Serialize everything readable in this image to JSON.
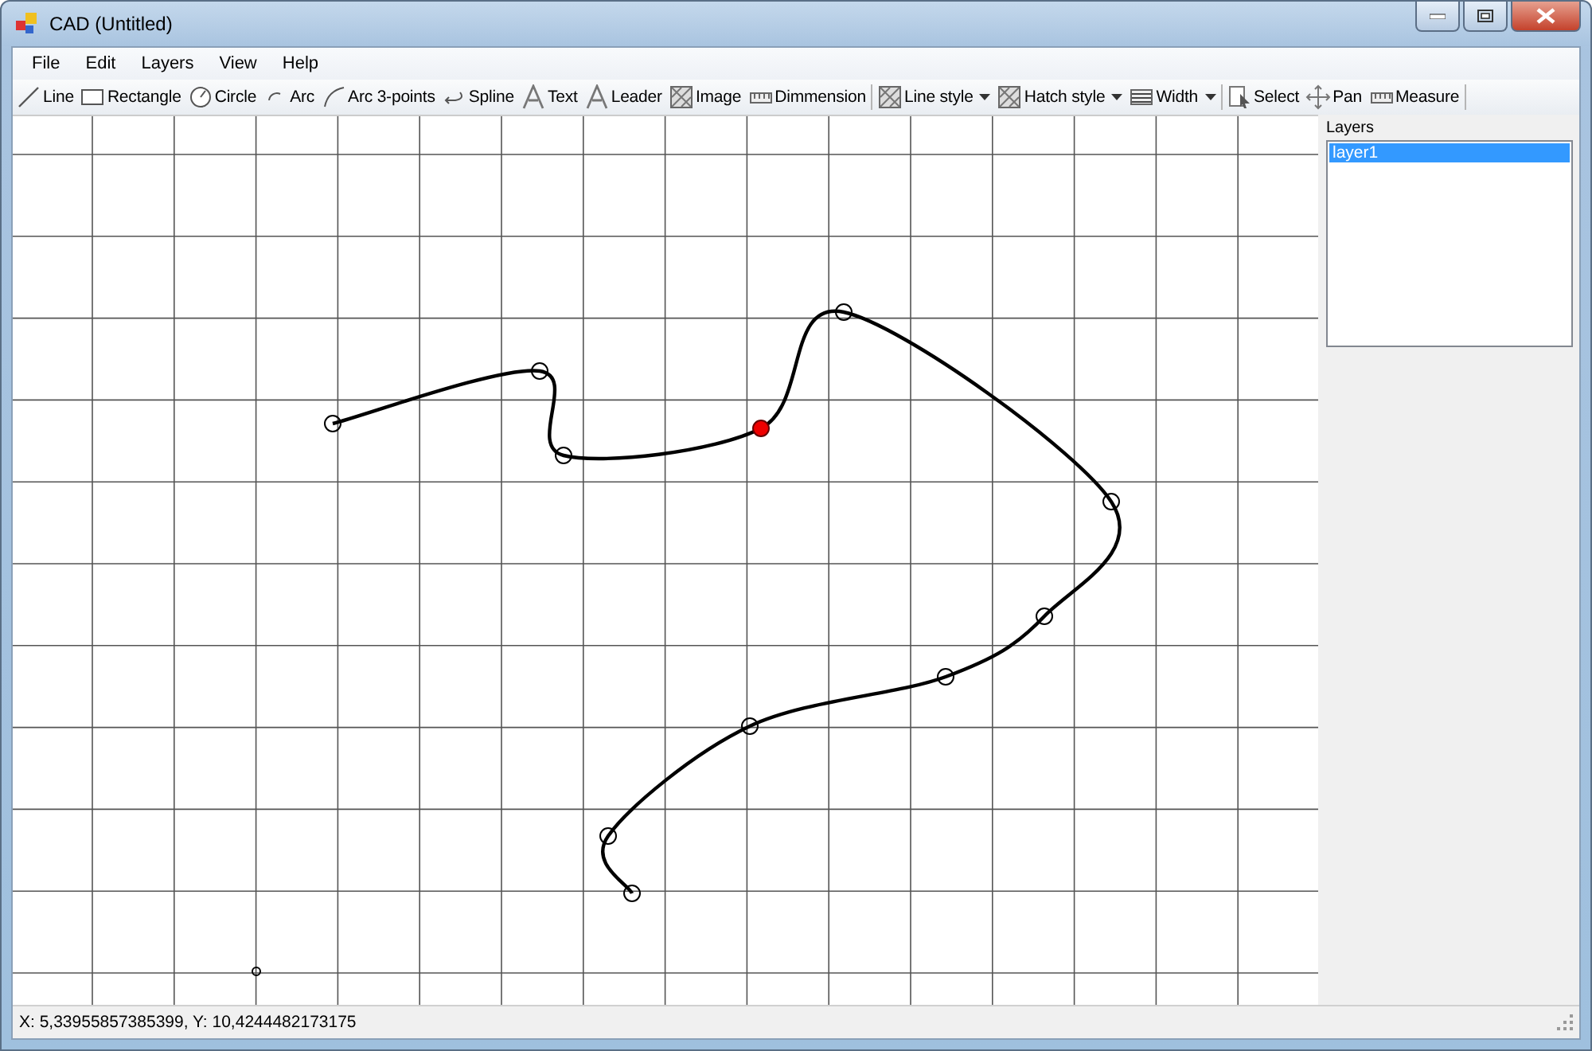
{
  "window": {
    "title": "CAD (Untitled)"
  },
  "menu": [
    "File",
    "Edit",
    "Layers",
    "View",
    "Help"
  ],
  "toolbar": [
    {
      "kind": "tool",
      "label": "Line"
    },
    {
      "kind": "tool",
      "label": "Rectangle"
    },
    {
      "kind": "tool",
      "label": "Circle"
    },
    {
      "kind": "tool",
      "label": "Arc"
    },
    {
      "kind": "tool",
      "label": "Arc 3-points"
    },
    {
      "kind": "tool",
      "label": "Spline"
    },
    {
      "kind": "tool",
      "label": "Text"
    },
    {
      "kind": "tool",
      "label": "Leader"
    },
    {
      "kind": "tool",
      "label": "Image"
    },
    {
      "kind": "tool",
      "label": "Dimmension"
    },
    {
      "kind": "separator"
    },
    {
      "kind": "dropdown",
      "label": "Line style"
    },
    {
      "kind": "dropdown",
      "label": "Hatch style"
    },
    {
      "kind": "dropdown",
      "label": "Width"
    },
    {
      "kind": "separator"
    },
    {
      "kind": "tool",
      "label": "Select"
    },
    {
      "kind": "tool",
      "label": "Pan"
    },
    {
      "kind": "tool",
      "label": "Measure"
    },
    {
      "kind": "separator"
    }
  ],
  "layers_panel": {
    "title": "Layers",
    "items": [
      {
        "label": "layer1",
        "selected": true
      }
    ]
  },
  "status_bar": "X: 5,33955857385399, Y: 10,4244482173175"
}
